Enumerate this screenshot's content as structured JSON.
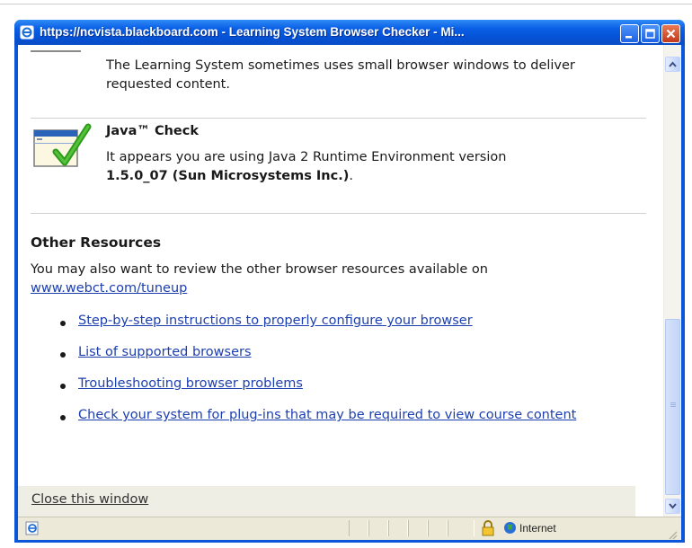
{
  "window": {
    "title": "https://ncvista.blackboard.com - Learning System Browser Checker - Mi..."
  },
  "popup_section": {
    "text": "The Learning System sometimes uses small browser windows to deliver requested content."
  },
  "java_check": {
    "title": "Java™ Check",
    "text_prefix": "It appears you are using Java 2 Runtime Environment version",
    "version": "1.5.0_07 (Sun Microsystems Inc.)",
    "period": "."
  },
  "other_resources": {
    "heading": "Other Resources",
    "intro": "You may also want to review the other browser resources available on",
    "link": "www.webct.com/tuneup",
    "items": [
      "Step-by-step instructions to properly configure your browser",
      "List of supported browsers",
      "Troubleshooting browser problems",
      "Check your system for plug-ins that may be required to view course content"
    ]
  },
  "footer": {
    "close_link": "Close this window"
  },
  "status_bar": {
    "zone": "Internet"
  },
  "colors": {
    "title_bar": "#0a5fe5",
    "link": "#1c3fb0",
    "check_mark": "#2e9a1c"
  },
  "icons": [
    "ie-page-icon",
    "minimize-icon",
    "maximize-icon",
    "close-icon",
    "java-check-icon",
    "lock-icon",
    "globe-icon",
    "resize-grip-icon"
  ]
}
